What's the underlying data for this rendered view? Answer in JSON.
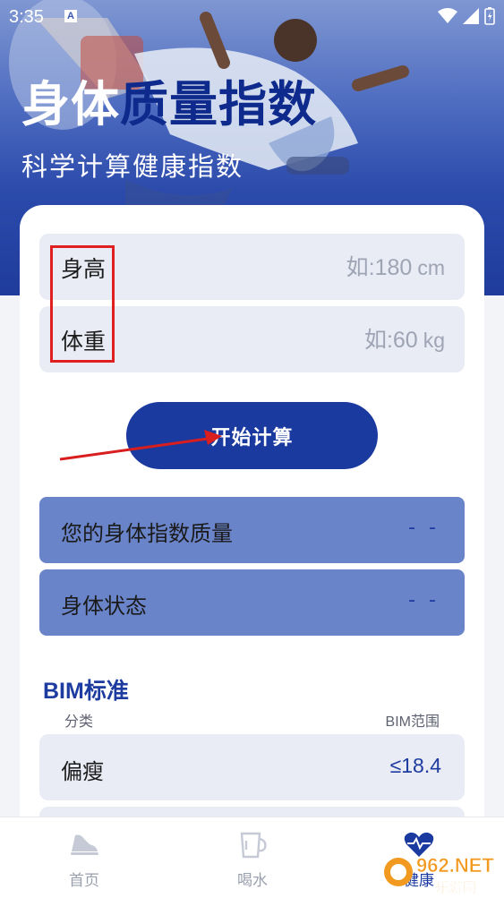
{
  "status_bar": {
    "time": "3:35",
    "app_icon_letter": "A"
  },
  "header": {
    "title_part1": "身体",
    "title_part2": "质量指数",
    "subtitle": "科学计算健康指数"
  },
  "form": {
    "height": {
      "label": "身高",
      "placeholder": "如:180",
      "unit": "cm"
    },
    "weight": {
      "label": "体重",
      "placeholder": "如:60",
      "unit": "kg"
    },
    "calc_button": "开始计算"
  },
  "results": [
    {
      "label": "您的身体指数质量",
      "value": "- -"
    },
    {
      "label": "身体状态",
      "value": "- -"
    }
  ],
  "bim_standard": {
    "title": "BIM标准",
    "col_category": "分类",
    "col_range": "BIM范围",
    "rows": [
      {
        "category": "偏瘦",
        "range": "≤18.4"
      }
    ]
  },
  "bottom_nav": [
    {
      "label": "首页",
      "icon": "shoe-icon",
      "active": false
    },
    {
      "label": "喝水",
      "icon": "cup-icon",
      "active": false
    },
    {
      "label": "健康",
      "icon": "heart-pulse-icon",
      "active": true
    }
  ],
  "watermark": {
    "text": "962.NET",
    "subtext": "乐游网"
  },
  "colors": {
    "primary": "#1b3a9f",
    "result_bg": "#6a84c9",
    "field_bg": "#e9ecf5",
    "highlight": "#e02020"
  }
}
